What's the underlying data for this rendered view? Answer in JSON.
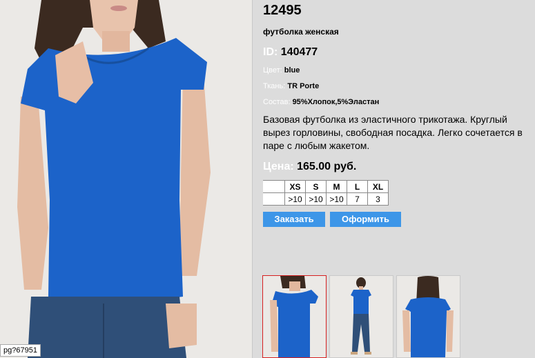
{
  "product": {
    "sku": "12495",
    "subtitle": "футболка женская",
    "id_label": "ID:",
    "id_value": "140477",
    "color_label": "Цвет:",
    "color_value": "blue",
    "fabric_label": "Ткань:",
    "fabric_value": "TR Porte",
    "composition_label": "Состав:",
    "composition_value": "95%Хлопок,5%Эластан",
    "description": "Базовая футболка из эластичного трикотажа. Круглый вырез горловины, свободная посадка. Легко сочетается в паре с любым жакетом.",
    "price_label": "Цена:",
    "price_value": "165.00 руб."
  },
  "sizes": {
    "headers": [
      "XS",
      "S",
      "M",
      "L",
      "XL"
    ],
    "stock": [
      ">10",
      ">10",
      ">10",
      "7",
      "3"
    ]
  },
  "buttons": {
    "order": "Заказать",
    "checkout": "Оформить"
  },
  "status_url": "pg?67951",
  "colors": {
    "accent": "#3d96e8",
    "shirt": "#1c63c9",
    "background": "#dcdcdc"
  }
}
